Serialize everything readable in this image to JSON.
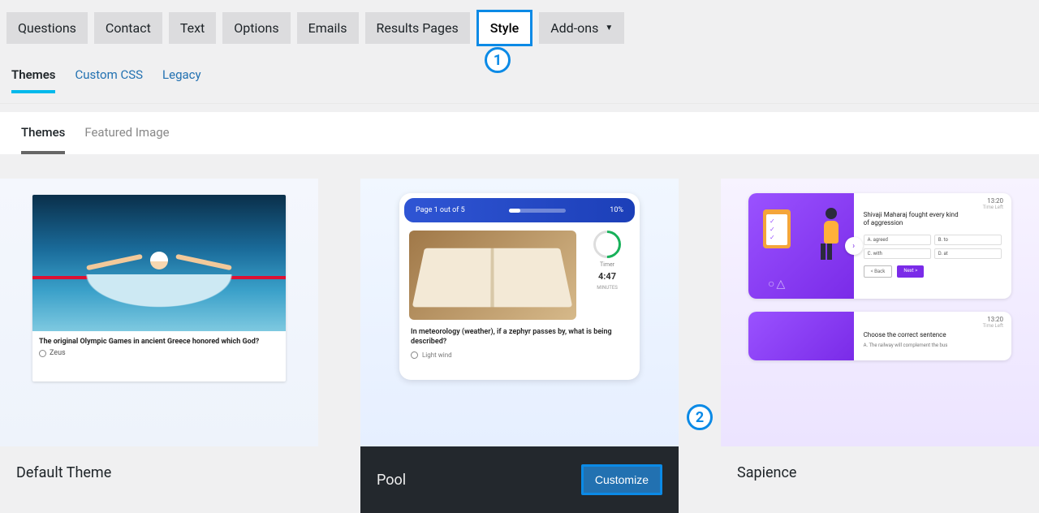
{
  "mainTabs": {
    "questions": "Questions",
    "contact": "Contact",
    "text": "Text",
    "options": "Options",
    "emails": "Emails",
    "results": "Results Pages",
    "style": "Style",
    "addons": "Add-ons"
  },
  "subTabs": {
    "themes": "Themes",
    "customcss": "Custom CSS",
    "legacy": "Legacy"
  },
  "panelTabs": {
    "themes": "Themes",
    "featured": "Featured Image"
  },
  "annotations": {
    "one": "1",
    "two": "2"
  },
  "cards": {
    "default": {
      "title": "Default Theme",
      "preview": {
        "question": "The original Olympic Games in ancient Greece honored which God?",
        "option1": "Zeus"
      }
    },
    "pool": {
      "title": "Pool",
      "customize": "Customize",
      "preview": {
        "pageLabel": "Page 1 out of 5",
        "percent": "10%",
        "timerLabel": "Timer",
        "timerValue": "4:47",
        "timerUnit": "MINUTES",
        "question": "In meteorology (weather), if a zephyr passes by, what is being described?",
        "option1": "Light wind"
      }
    },
    "sapience": {
      "title": "Sapience",
      "preview": {
        "time": "13:20",
        "timeSub": "Time Left",
        "q1": "Shivaji Maharaj fought every kind of aggression",
        "optA": "A. agreed",
        "optB": "B. to",
        "optC": "C. with",
        "optD": "D. at",
        "back": "< Back",
        "next": "Next >",
        "q2": "Choose the correct sentence",
        "q2opt": "A. The railway will complement the bus"
      }
    }
  }
}
